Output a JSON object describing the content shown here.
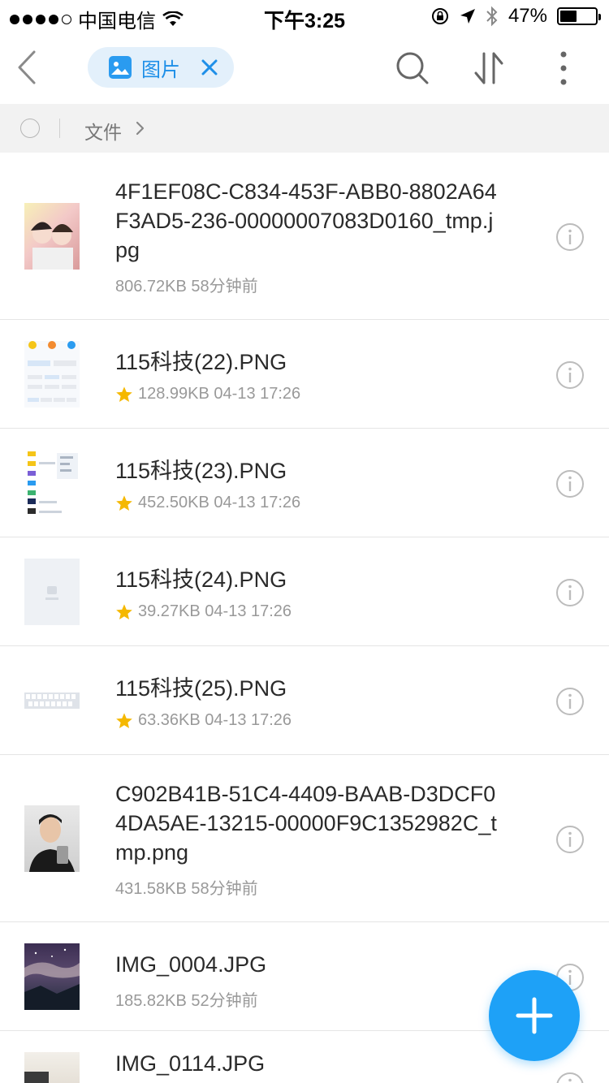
{
  "status_bar": {
    "carrier": "中国电信",
    "time": "下午3:25",
    "battery": "47%",
    "battery_level": 0.47
  },
  "nav": {
    "filter_label": "图片",
    "icons": [
      "back-arrow-icon",
      "image-icon",
      "close-icon",
      "search-icon",
      "sort-icon",
      "more-vertical-icon"
    ]
  },
  "breadcrumb": {
    "label": "文件"
  },
  "files": [
    {
      "name": "4F1EF08C-C834-453F-ABB0-8802A64F3AD5-236-00000007083D0160_tmp.jpg",
      "meta": "806.72KB 58分钟前",
      "starred": false
    },
    {
      "name": "115科技(22).PNG",
      "meta": "128.99KB 04-13 17:26",
      "starred": true
    },
    {
      "name": "115科技(23).PNG",
      "meta": "452.50KB 04-13 17:26",
      "starred": true
    },
    {
      "name": "115科技(24).PNG",
      "meta": "39.27KB 04-13 17:26",
      "starred": true
    },
    {
      "name": "115科技(25).PNG",
      "meta": "63.36KB 04-13 17:26",
      "starred": true
    },
    {
      "name": "C902B41B-51C4-4409-BAAB-D3DCF04DA5AE-13215-00000F9C1352982C_tmp.png",
      "meta": "431.58KB 58分钟前",
      "starred": false
    },
    {
      "name": "IMG_0004.JPG",
      "meta": "185.82KB 52分钟前",
      "starred": false
    },
    {
      "name": "IMG_0114.JPG",
      "meta": "",
      "starred": false
    }
  ],
  "colors": {
    "accent": "#1ea1f7",
    "chip_bg": "#e3f0fb",
    "star": "#f5b800"
  }
}
